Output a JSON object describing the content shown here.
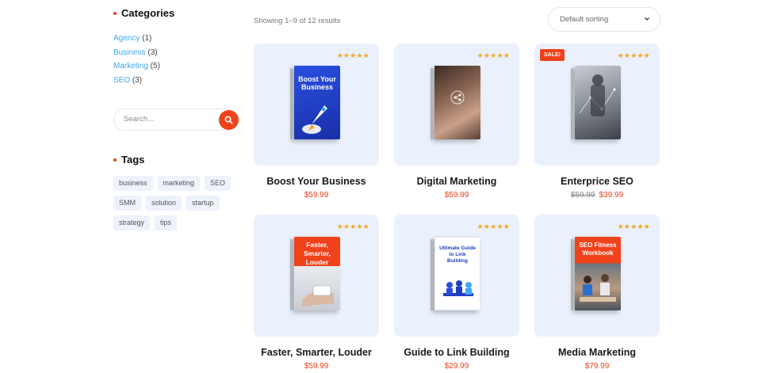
{
  "sidebar": {
    "categories_title": "Categories",
    "categories": [
      {
        "name": "Agency",
        "count": "(1)"
      },
      {
        "name": "Business",
        "count": "(3)"
      },
      {
        "name": "Marketing",
        "count": "(5)"
      },
      {
        "name": "SEO",
        "count": "(3)"
      }
    ],
    "search_placeholder": "Search...",
    "tags_title": "Tags",
    "tags": [
      "business",
      "marketing",
      "SEO",
      "SMM",
      "solution",
      "startup",
      "strategy",
      "tips"
    ]
  },
  "toolbar": {
    "result_count": "Showing 1–9 of 12 results",
    "sorting": "Default sorting"
  },
  "products": [
    {
      "title": "Boost Your Business",
      "price": "$59.99",
      "old_price": "",
      "stars": "★★★★★",
      "sale": "",
      "cover_text": "Boost Your Business",
      "cover_color": "#1f3fc0"
    },
    {
      "title": "Digital Marketing",
      "price": "$59.99",
      "old_price": "",
      "stars": "★★★★★",
      "sale": "",
      "cover_text": "",
      "cover_color": "#6b4a3a"
    },
    {
      "title": "Enterprice SEO",
      "price": "$39.99",
      "old_price": "$59.99",
      "stars": "★★★★★",
      "sale": "SALE!",
      "cover_text": "",
      "cover_color": "#5d6470"
    },
    {
      "title": "Faster, Smarter, Louder",
      "price": "$59.99",
      "old_price": "",
      "stars": "★★★★★",
      "sale": "",
      "cover_text": "Faster, Smarter, Louder",
      "cover_color": "#f0421b"
    },
    {
      "title": "Guide to Link Building",
      "price": "$29.99",
      "old_price": "",
      "stars": "★★★★★",
      "sale": "",
      "cover_text": "Ultimate Guide to Link Building",
      "cover_color": "#ffffff"
    },
    {
      "title": "Media Marketing",
      "price": "$79.99",
      "old_price": "",
      "stars": "★★★★★",
      "sale": "",
      "cover_text": "SEO Fitness Workbook",
      "cover_color": "#f0421b"
    }
  ],
  "colors": {
    "accent": "#f0421b",
    "link": "#3da8f5",
    "card_bg": "#eaf1fc",
    "star": "#f5a623"
  }
}
